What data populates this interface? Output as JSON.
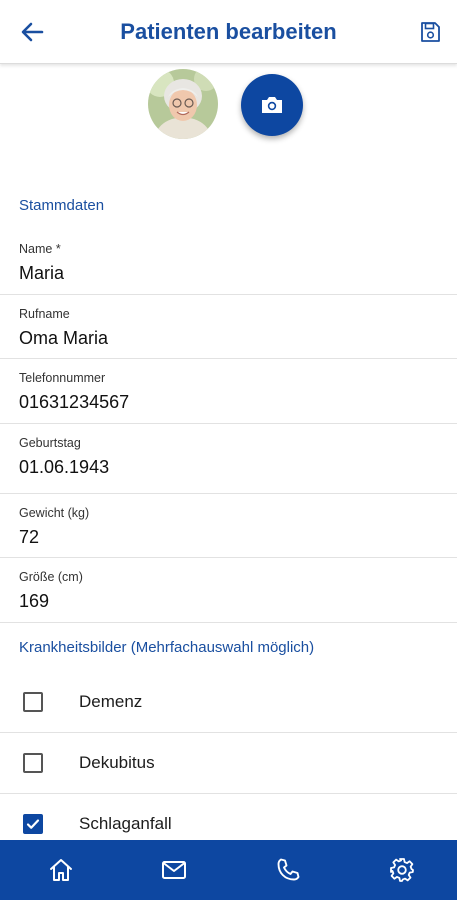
{
  "header": {
    "title": "Patienten bearbeiten",
    "back_icon": "arrow-left-icon",
    "save_icon": "save-icon"
  },
  "profile": {
    "avatar": "patient-photo",
    "camera_icon": "camera-icon"
  },
  "stammdaten": {
    "section_title": "Stammdaten",
    "fields": [
      {
        "label": "Name *",
        "value": "Maria"
      },
      {
        "label": "Rufname",
        "value": "Oma Maria"
      },
      {
        "label": "Telefonnummer",
        "value": "01631234567"
      },
      {
        "label": "Geburtstag",
        "value": "01.06.1943"
      },
      {
        "label": "Gewicht (kg)",
        "value": "72"
      },
      {
        "label": "Größe (cm)",
        "value": "169"
      }
    ]
  },
  "krankheitsbilder": {
    "section_title": "Krankheitsbilder (Mehrfachauswahl möglich)",
    "options": [
      {
        "label": "Demenz",
        "checked": false
      },
      {
        "label": "Dekubitus",
        "checked": false
      },
      {
        "label": "Schlaganfall",
        "checked": true
      }
    ]
  },
  "bottom_nav": {
    "items": [
      "home-icon",
      "mail-icon",
      "phone-icon",
      "settings-icon"
    ]
  },
  "colors": {
    "primary": "#0d47a1",
    "title": "#1a4fa0"
  }
}
